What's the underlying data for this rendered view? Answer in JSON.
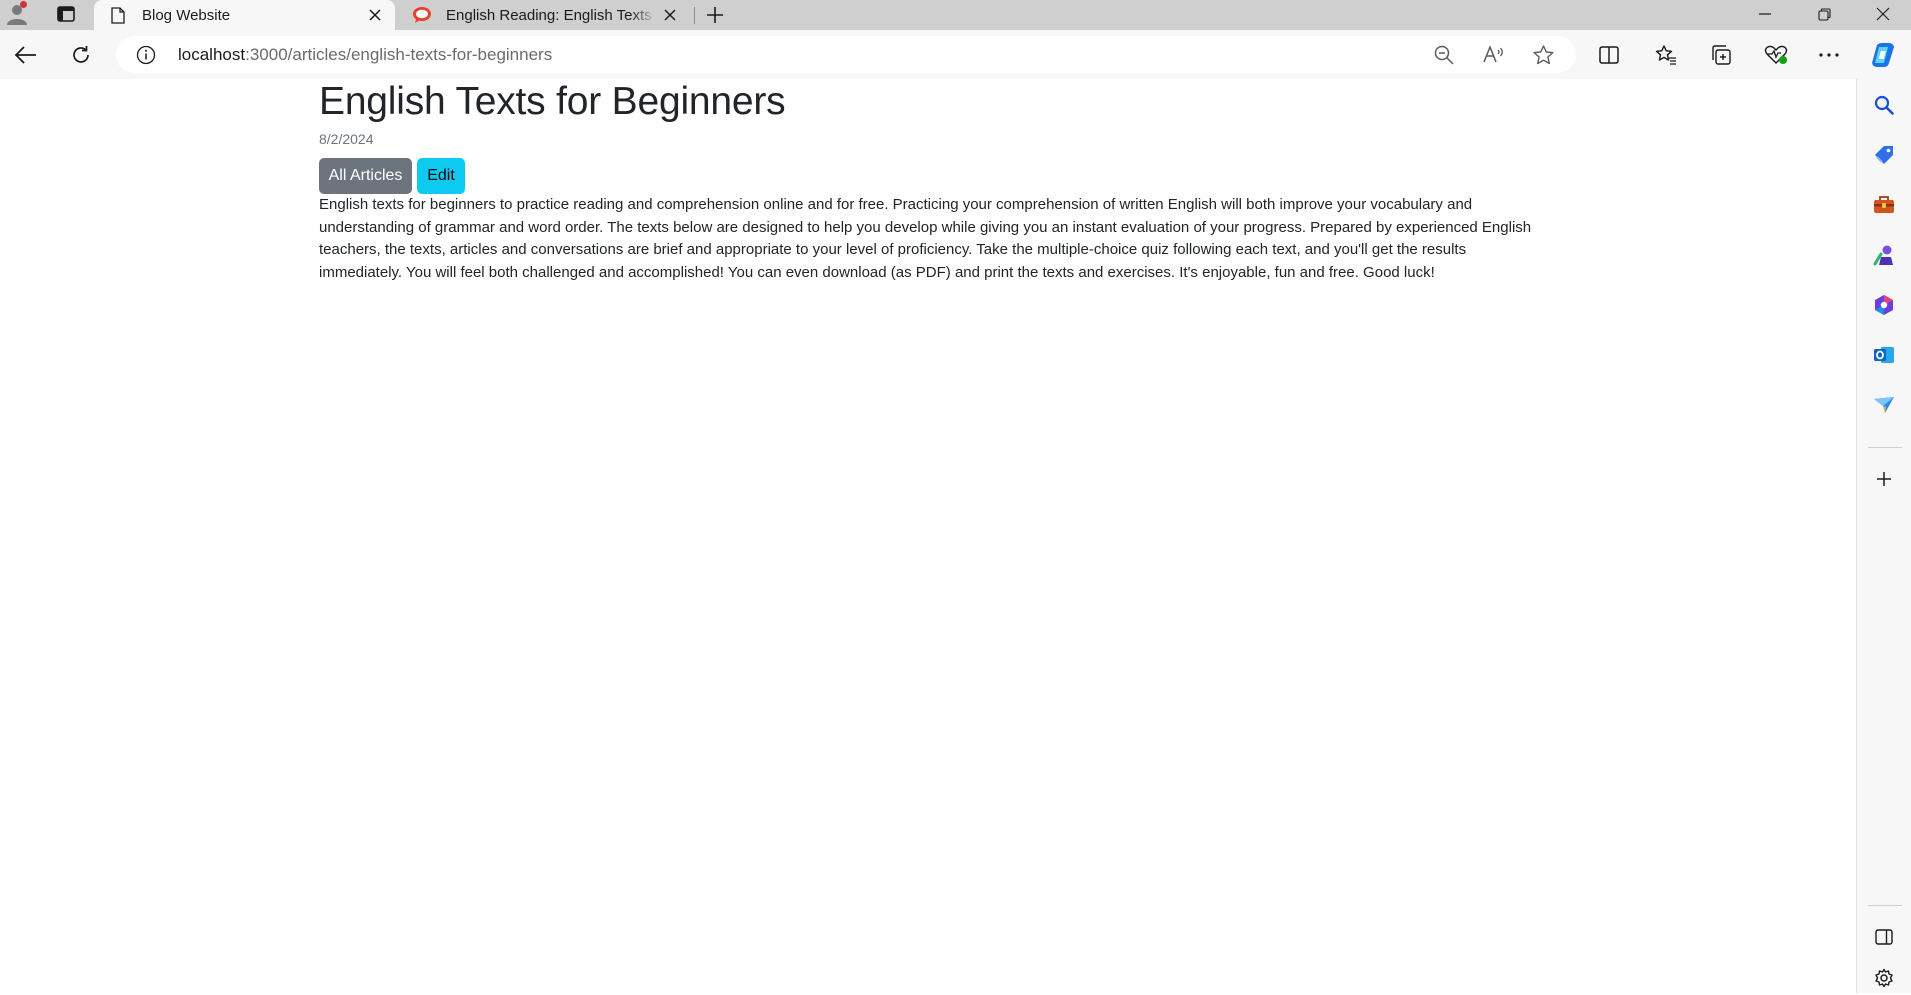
{
  "browser": {
    "tabs": [
      {
        "title": "Blog Website",
        "active": true,
        "icon": "page-icon"
      },
      {
        "title": "English Reading: English Texts for Beginners",
        "active": false,
        "icon": "site-favicon-icon"
      }
    ],
    "url_host": "localhost",
    "url_path": ":3000/articles/english-texts-for-beginners",
    "accent_color": "#1a73e8"
  },
  "article": {
    "title": "English Texts for Beginners",
    "date": "8/2/2024",
    "buttons": {
      "all_articles": "All Articles",
      "edit": "Edit"
    },
    "body": "English texts for beginners to practice reading and comprehension online and for free. Practicing your comprehension of written English will both improve your vocabulary and understanding of grammar and word order. The texts below are designed to help you develop while giving you an instant evaluation of your progress. Prepared by experienced English teachers, the texts, articles and conversations are brief and appropriate to your level of proficiency. Take the multiple-choice quiz following each text, and you'll get the results immediately. You will feel both challenged and accomplished! You can even download (as PDF) and print the texts and exercises. It's enjoyable, fun and free. Good luck!"
  },
  "colors": {
    "btn_secondary": "#6c757d",
    "btn_info": "#0dcaf0",
    "text_muted": "#6c757d"
  }
}
